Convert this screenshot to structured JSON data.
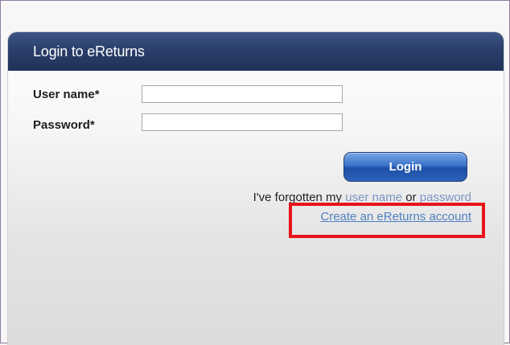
{
  "panel": {
    "title": "Login to eReturns"
  },
  "form": {
    "username_label": "User name*",
    "username_value": "",
    "password_label": "Password*",
    "password_value": "",
    "login_button": "Login"
  },
  "links": {
    "forgot_prefix": "I've forgotten my ",
    "forgot_username": "user name",
    "forgot_or": " or ",
    "forgot_password": "password",
    "create_account": "Create an eReturns account"
  },
  "annotation": {
    "highlight_color": "#e8141a"
  },
  "colors": {
    "header_bg": "#2a3f6a",
    "link_color": "#4f7fc0",
    "button_blue": "#2d62bb"
  }
}
